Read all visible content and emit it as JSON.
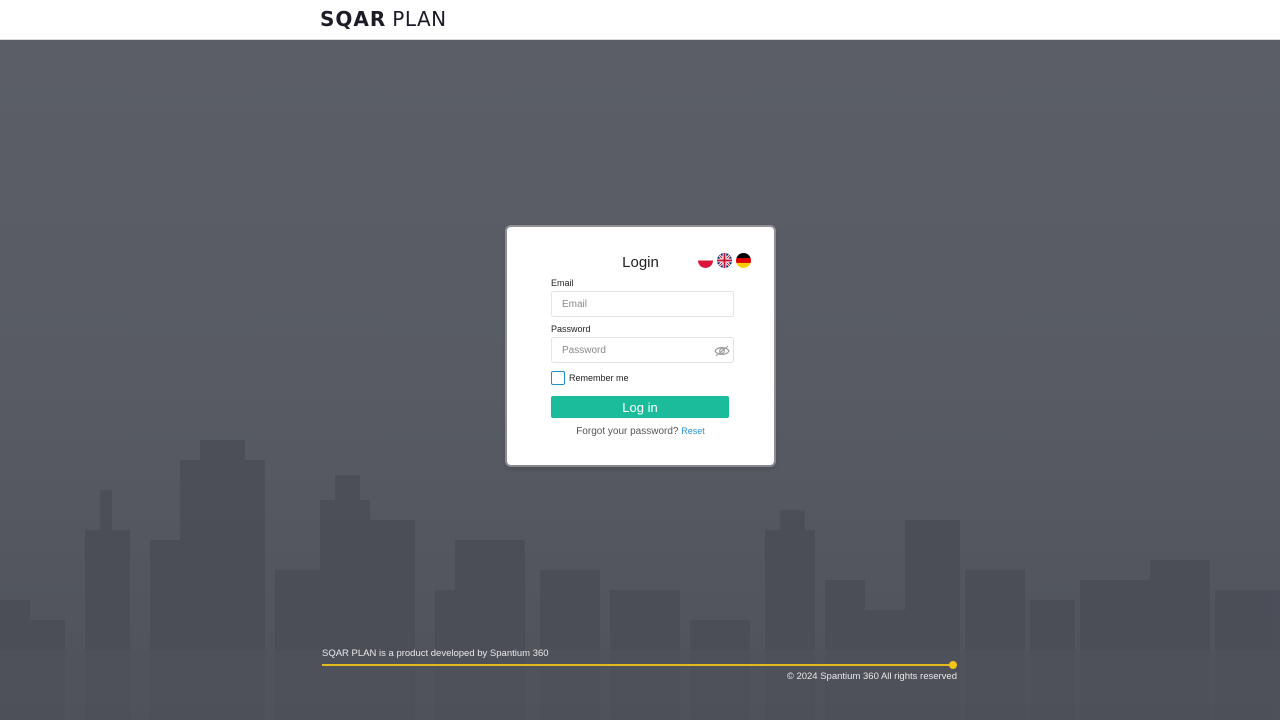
{
  "header": {
    "logo_bold": "SQAR",
    "logo_light": "PLAN"
  },
  "login": {
    "title": "Login",
    "email_label": "Email",
    "email_placeholder": "Email",
    "email_value": "",
    "password_label": "Password",
    "password_placeholder": "Password",
    "password_value": "",
    "remember_label": "Remember me",
    "remember_checked": false,
    "button_label": "Log in",
    "forgot_text": "Forgot your password?",
    "reset_link": "Reset",
    "languages": [
      {
        "icon": "flag-poland-icon"
      },
      {
        "icon": "flag-uk-icon"
      },
      {
        "icon": "flag-germany-icon"
      }
    ]
  },
  "footer": {
    "product_text": "SQAR PLAN is a product developed by Spantium 360",
    "copyright": "© 2024 Spantium 360 All rights reserved"
  },
  "colors": {
    "accent": "#1bbc9b",
    "link": "#2a8fd6",
    "footer_line": "#e3b91c",
    "background": "#5a5d66"
  }
}
